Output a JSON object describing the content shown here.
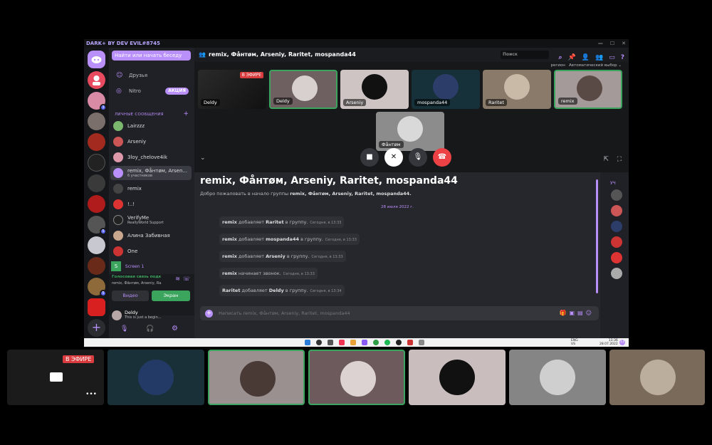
{
  "window": {
    "title": "DARK+ BY DEV EVIL#8745",
    "controls": [
      "—",
      "☐",
      "✕"
    ]
  },
  "guild_badges": {
    "g2": "3",
    "g6": "5",
    "g9": "5"
  },
  "dm_panel": {
    "search_placeholder": "Найти или начать беседу",
    "friends_label": "Друзья",
    "nitro_label": "Nitro",
    "promo_badge": "АКЦИЯ",
    "section_header": "ЛИЧНЫЕ СООБЩЕНИЯ",
    "dms": [
      {
        "name": "Lairzzz",
        "sub": ""
      },
      {
        "name": "Arseniy",
        "sub": ""
      },
      {
        "name": "3loy_chelove4ik",
        "sub": ""
      },
      {
        "name": "remix, Фåнтøм, Arsen...",
        "sub": "6 участников"
      },
      {
        "name": "remix",
        "sub": ""
      },
      {
        "name": "!..!",
        "sub": ""
      },
      {
        "name": "VerifyMe",
        "sub": "ReallyWorld Support"
      },
      {
        "name": "Алина Забивная",
        "sub": ""
      },
      {
        "name": "One",
        "sub": ""
      }
    ],
    "screen_share_label": "Screen 1",
    "voice": {
      "title": "Голосовая связь подк",
      "sub": "remix, Фåнтøм, Arseniy, Ra...",
      "video_label": "Видео",
      "screen_label": "Экран"
    },
    "user": {
      "name": "Deldy",
      "status": "This is just a begin..."
    }
  },
  "call": {
    "header": "remix, Фåнтøм, Arseniy, Raritet, mospanda44",
    "search_placeholder": "Поиск",
    "region_label": "регион",
    "region_value": "Автоматический выбор",
    "live_badge": "В ЭФИРЕ",
    "tiles": [
      {
        "label": "Deldy"
      },
      {
        "label": "Deldy"
      },
      {
        "label": "Arseniy"
      },
      {
        "label": "mospanda44"
      },
      {
        "label": "Raritet"
      },
      {
        "label": "remix"
      },
      {
        "label": "Фåнтøм"
      }
    ]
  },
  "chat": {
    "title": "remix, Фåнтøм, Arseniy, Raritet, mospanda44",
    "welcome_prefix": "Добро пожаловать в начало группы",
    "welcome_names": "remix, Фåнтøм, Arseniy, Raritet, mospanda44.",
    "date_divider": "28 июля 2022 г.",
    "messages": [
      {
        "actor": "remix",
        "action": "добавляет",
        "target": "Raritet",
        "suffix": "в группу.",
        "time": "Сегодня, в 13:33"
      },
      {
        "actor": "remix",
        "action": "добавляет",
        "target": "mospanda44",
        "suffix": "в группу.",
        "time": "Сегодня, в 13:33"
      },
      {
        "actor": "remix",
        "action": "добавляет",
        "target": "Arseniy",
        "suffix": "в группу.",
        "time": "Сегодня, в 13:33"
      },
      {
        "actor": "remix",
        "action": "начинает звонок.",
        "target": "",
        "suffix": "",
        "time": "Сегодня, в 13:33"
      },
      {
        "actor": "Raritet",
        "action": "добавляет",
        "target": "Deldy",
        "suffix": "в группу.",
        "time": "Сегодня, в 13:34"
      }
    ],
    "composer_placeholder": "Написать remix, Фåнтøм, Arseniy, Raritet, mospanda44",
    "members_label": "УЧ"
  },
  "taskbar": {
    "lang": "ENG",
    "lang_sub": "US",
    "time": "13:36",
    "date": "28.07.2022",
    "notif": "13"
  },
  "bottom_strip": {
    "live_badge": "В ЭФИРЕ",
    "more_label": "•••"
  }
}
